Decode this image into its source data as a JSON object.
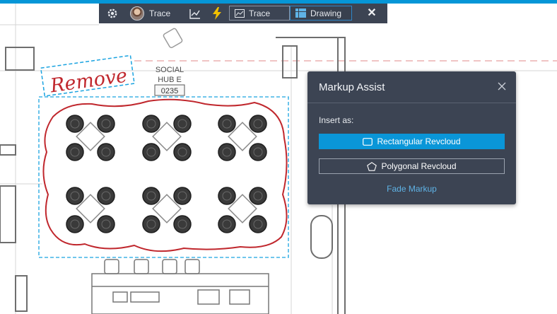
{
  "toolbar": {
    "user_label": "Trace",
    "tabs": [
      {
        "label": "Trace",
        "icon": "trace-icon"
      },
      {
        "label": "Drawing",
        "icon": "drawing-grid-icon",
        "selected": true
      }
    ],
    "close_glyph": "✕"
  },
  "drawing": {
    "room_name_line1": "SOCIAL",
    "room_name_line2": "HUB E",
    "room_number": "0235",
    "markup_text": "Remove",
    "markup_color": "#c0272d",
    "selection_color": "#1aa3e0"
  },
  "panel": {
    "title": "Markup Assist",
    "insert_label": "Insert as:",
    "rect_button": "Rectangular Revcloud",
    "poly_button": "Polygonal Revcloud",
    "fade_link": "Fade Markup"
  },
  "colors": {
    "accent": "#0696d7",
    "panel_bg": "#3c4453",
    "link": "#5fb3e6"
  }
}
